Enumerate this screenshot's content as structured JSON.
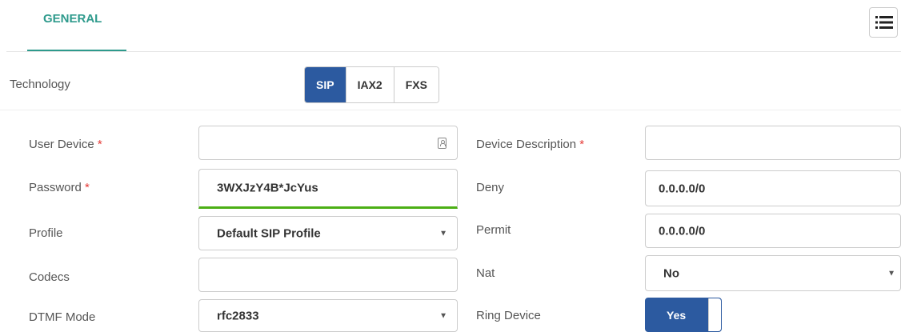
{
  "tabs": [
    {
      "label": "GENERAL",
      "active": true
    }
  ],
  "menu_icon": "list-icon",
  "technology": {
    "label": "Technology",
    "options": [
      "SIP",
      "IAX2",
      "FXS"
    ],
    "selected": "SIP"
  },
  "left_fields": {
    "user_device": {
      "label": "User Device",
      "required_mark": "*",
      "value": "",
      "icon": "contact-card-icon"
    },
    "password": {
      "label": "Password",
      "required_mark": "*",
      "value": "3WXJzY4B*JcYus"
    },
    "profile": {
      "label": "Profile",
      "value": "Default SIP Profile",
      "caret": "▼"
    },
    "codecs": {
      "label": "Codecs",
      "value": ""
    },
    "dtmf_mode": {
      "label": "DTMF Mode",
      "value": "rfc2833",
      "caret": "▼"
    }
  },
  "right_fields": {
    "device_description": {
      "label": "Device Description",
      "required_mark": "*",
      "value": ""
    },
    "deny": {
      "label": "Deny",
      "value": "0.0.0.0/0"
    },
    "permit": {
      "label": "Permit",
      "value": "0.0.0.0/0"
    },
    "nat": {
      "label": "Nat",
      "value": "No",
      "caret": "▼"
    },
    "ring_device": {
      "label": "Ring Device",
      "value": "Yes"
    }
  },
  "colors": {
    "accent_teal": "#2e9a8c",
    "primary_blue": "#2c5aa0",
    "valid_green": "#4caf15",
    "required_red": "#e53935"
  }
}
